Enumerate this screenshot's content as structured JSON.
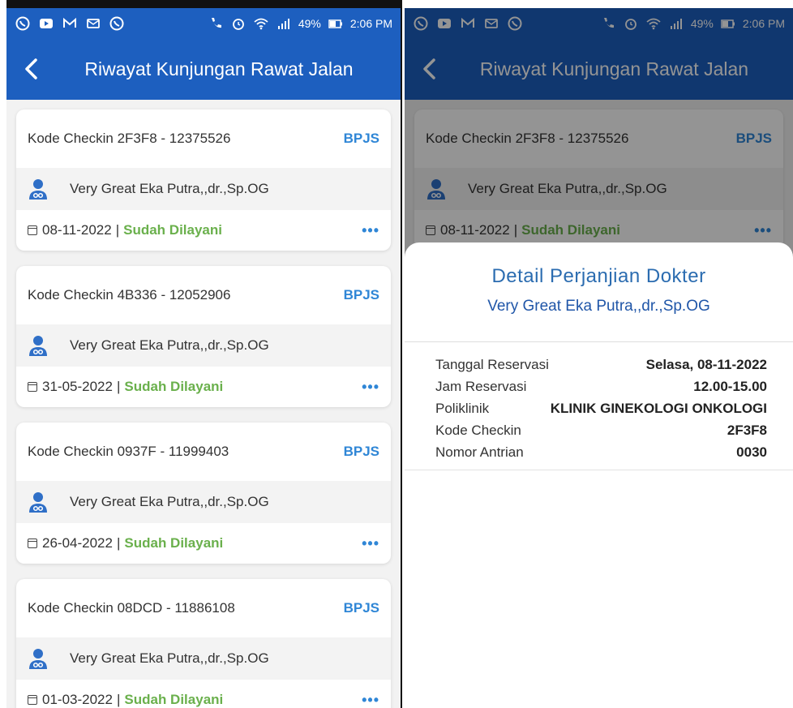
{
  "status": {
    "time": "2:06 PM",
    "battery": "49%"
  },
  "appbar": {
    "title": "Riwayat Kunjungan Rawat Jalan"
  },
  "visits": [
    {
      "code": "Kode Checkin 2F3F8 - 12375526",
      "badge": "BPJS",
      "doctor": "Very Great Eka Putra,,dr.,Sp.OG",
      "date": "08-11-2022",
      "separator": "|",
      "status": "Sudah Dilayani",
      "more": "•••"
    },
    {
      "code": "Kode Checkin 4B336 - 12052906",
      "badge": "BPJS",
      "doctor": "Very Great Eka Putra,,dr.,Sp.OG",
      "date": "31-05-2022",
      "separator": "|",
      "status": "Sudah Dilayani",
      "more": "•••"
    },
    {
      "code": "Kode Checkin 0937F - 11999403",
      "badge": "BPJS",
      "doctor": "Very Great Eka Putra,,dr.,Sp.OG",
      "date": "26-04-2022",
      "separator": "|",
      "status": "Sudah Dilayani",
      "more": "•••"
    },
    {
      "code": "Kode Checkin 08DCD - 11886108",
      "badge": "BPJS",
      "doctor": "Very Great Eka Putra,,dr.,Sp.OG",
      "date": "01-03-2022",
      "separator": "|",
      "status": "Sudah Dilayani",
      "more": "•••"
    }
  ],
  "detail": {
    "title": "Detail Perjanjian Dokter",
    "doctor": "Very Great Eka Putra,,dr.,Sp.OG",
    "rows": [
      {
        "label": "Tanggal Reservasi",
        "value": "Selasa, 08-11-2022"
      },
      {
        "label": "Jam Reservasi",
        "value": "12.00-15.00"
      },
      {
        "label": "Poliklinik",
        "value": "KLINIK GINEKOLOGI ONKOLOGI"
      },
      {
        "label": "Kode Checkin",
        "value": "2F3F8"
      },
      {
        "label": "Nomor Antrian",
        "value": "0030"
      }
    ]
  },
  "colors": {
    "primary": "#1d5fbf",
    "badge": "#2f86d6",
    "served": "#6ab04c"
  }
}
